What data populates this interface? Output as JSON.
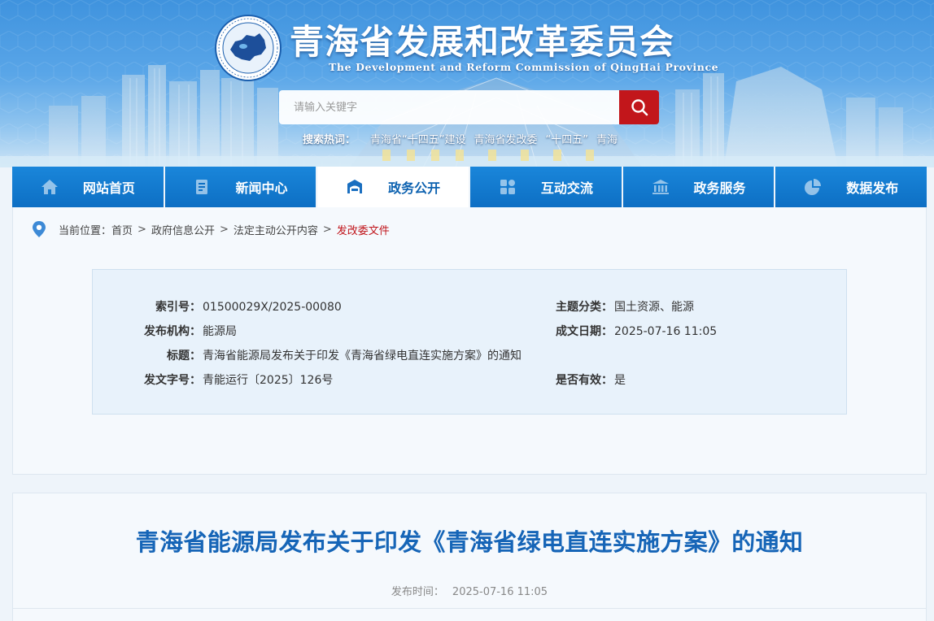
{
  "header": {
    "title": "青海省发展和改革委员会",
    "subtitle": "The Development and Reform Commission of QingHai Province",
    "emblem_icon": "province-map-emblem-icon"
  },
  "search": {
    "placeholder": "请输入关键字",
    "button_icon": "search-icon",
    "hotwords_label": "搜索热词：",
    "hotwords": [
      "青海省“十四五”建设",
      "青海省发改委",
      "“十四五”",
      "青海"
    ]
  },
  "nav": {
    "items": [
      {
        "label": "网站首页",
        "icon": "home-icon"
      },
      {
        "label": "新闻中心",
        "icon": "news-icon"
      },
      {
        "label": "政务公开",
        "icon": "open-gov-icon",
        "active": true
      },
      {
        "label": "互动交流",
        "icon": "interaction-icon"
      },
      {
        "label": "政务服务",
        "icon": "service-icon"
      },
      {
        "label": "数据发布",
        "icon": "data-pie-icon"
      }
    ]
  },
  "breadcrumb": {
    "label": "当前位置：",
    "items": [
      "首页",
      "政府信息公开",
      "法定主动公开内容",
      "发改委文件"
    ],
    "separator": ">"
  },
  "meta": {
    "index_no": {
      "key": "索引号：",
      "value": "01500029X/2025-00080"
    },
    "topic": {
      "key": "主题分类：",
      "value": "国土资源、能源"
    },
    "publisher": {
      "key": "发布机构：",
      "value": "能源局"
    },
    "date": {
      "key": "成文日期：",
      "value": "2025-07-16 11:05"
    },
    "title": {
      "key": "标题：",
      "value": "青海省能源局发布关于印发《青海省绿电直连实施方案》的通知"
    },
    "doc_no": {
      "key": "发文字号：",
      "value": "青能运行〔2025〕126号"
    },
    "valid": {
      "key": "是否有效：",
      "value": "是"
    }
  },
  "article": {
    "title": "青海省能源局发布关于印发《青海省绿电直连实施方案》的通知",
    "pub_label": "发布时间：",
    "pub_time": "2025-07-16 11:05"
  },
  "colors": {
    "nav_blue": "#0d6fc4",
    "search_red": "#c2161b",
    "title_blue": "#1665b7",
    "breadcrumb_current": "#c0151b"
  }
}
